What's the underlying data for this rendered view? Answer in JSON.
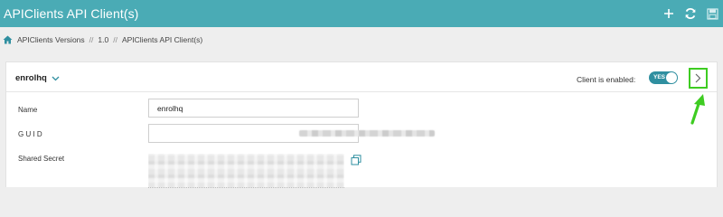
{
  "header": {
    "title": "APIClients API Client(s)",
    "actions": [
      {
        "icon": "plus-icon"
      },
      {
        "icon": "refresh-icon"
      },
      {
        "icon": "save-icon"
      }
    ]
  },
  "breadcrumb": {
    "home_icon": "home-icon",
    "items": [
      "APIClients Versions",
      "1.0",
      "APIClients API Client(s)"
    ],
    "separator": "//"
  },
  "client": {
    "name": "enrolhq",
    "enabled_label": "Client is enabled:",
    "toggle_text": "YES",
    "enabled": true
  },
  "form": {
    "name_label": "Name",
    "name_value": "enrolhq",
    "guid_label": "G U I D",
    "secret_label": "Shared Secret"
  },
  "colors": {
    "header_bg": "#4aabb5",
    "toggle_on": "#2f8fa0",
    "annotation_green": "#3ecc22"
  }
}
